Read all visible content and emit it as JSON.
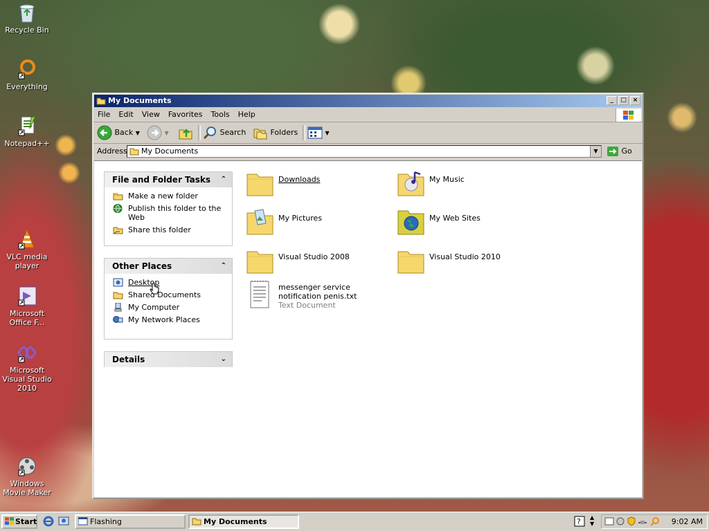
{
  "desktop": {
    "icons": [
      {
        "label": "Recycle Bin"
      },
      {
        "label": "Everything"
      },
      {
        "label": "Notepad++"
      },
      {
        "label": "VLC media player"
      },
      {
        "label": "Microsoft Office F..."
      },
      {
        "label": "Microsoft Visual Studio 2010"
      },
      {
        "label": "Windows Movie Maker"
      }
    ]
  },
  "window": {
    "title": "My Documents",
    "menu": [
      "File",
      "Edit",
      "View",
      "Favorites",
      "Tools",
      "Help"
    ],
    "toolbar": {
      "back": "Back",
      "search": "Search",
      "folders": "Folders"
    },
    "address": {
      "label": "Address",
      "value": "My Documents",
      "go": "Go"
    },
    "tasks_pane": {
      "title": "File and Folder Tasks",
      "items": [
        "Make a new folder",
        "Publish this folder to the Web",
        "Share this folder"
      ]
    },
    "places_pane": {
      "title": "Other Places",
      "items": [
        "Desktop",
        "Shared Documents",
        "My Computer",
        "My Network Places"
      ]
    },
    "details_pane": {
      "title": "Details"
    },
    "items": [
      {
        "name": "Downloads",
        "icon": "folder-icon"
      },
      {
        "name": "My Music",
        "icon": "music-folder-icon"
      },
      {
        "name": "My Pictures",
        "icon": "pictures-folder-icon"
      },
      {
        "name": "My Web Sites",
        "icon": "web-folder-icon"
      },
      {
        "name": "Visual Studio 2008",
        "icon": "folder-icon"
      },
      {
        "name": "Visual Studio 2010",
        "icon": "folder-icon"
      },
      {
        "name": "messenger service notification penis.txt",
        "type": "Text Document",
        "icon": "text-document-icon"
      }
    ]
  },
  "taskbar": {
    "start": "Start",
    "tasks": [
      "Flashing",
      "My Documents"
    ],
    "clock": "9:02 AM"
  },
  "colors": {
    "titlebar": "#0a246a",
    "face": "#d4d0c8",
    "folder": "#f5d76e"
  }
}
